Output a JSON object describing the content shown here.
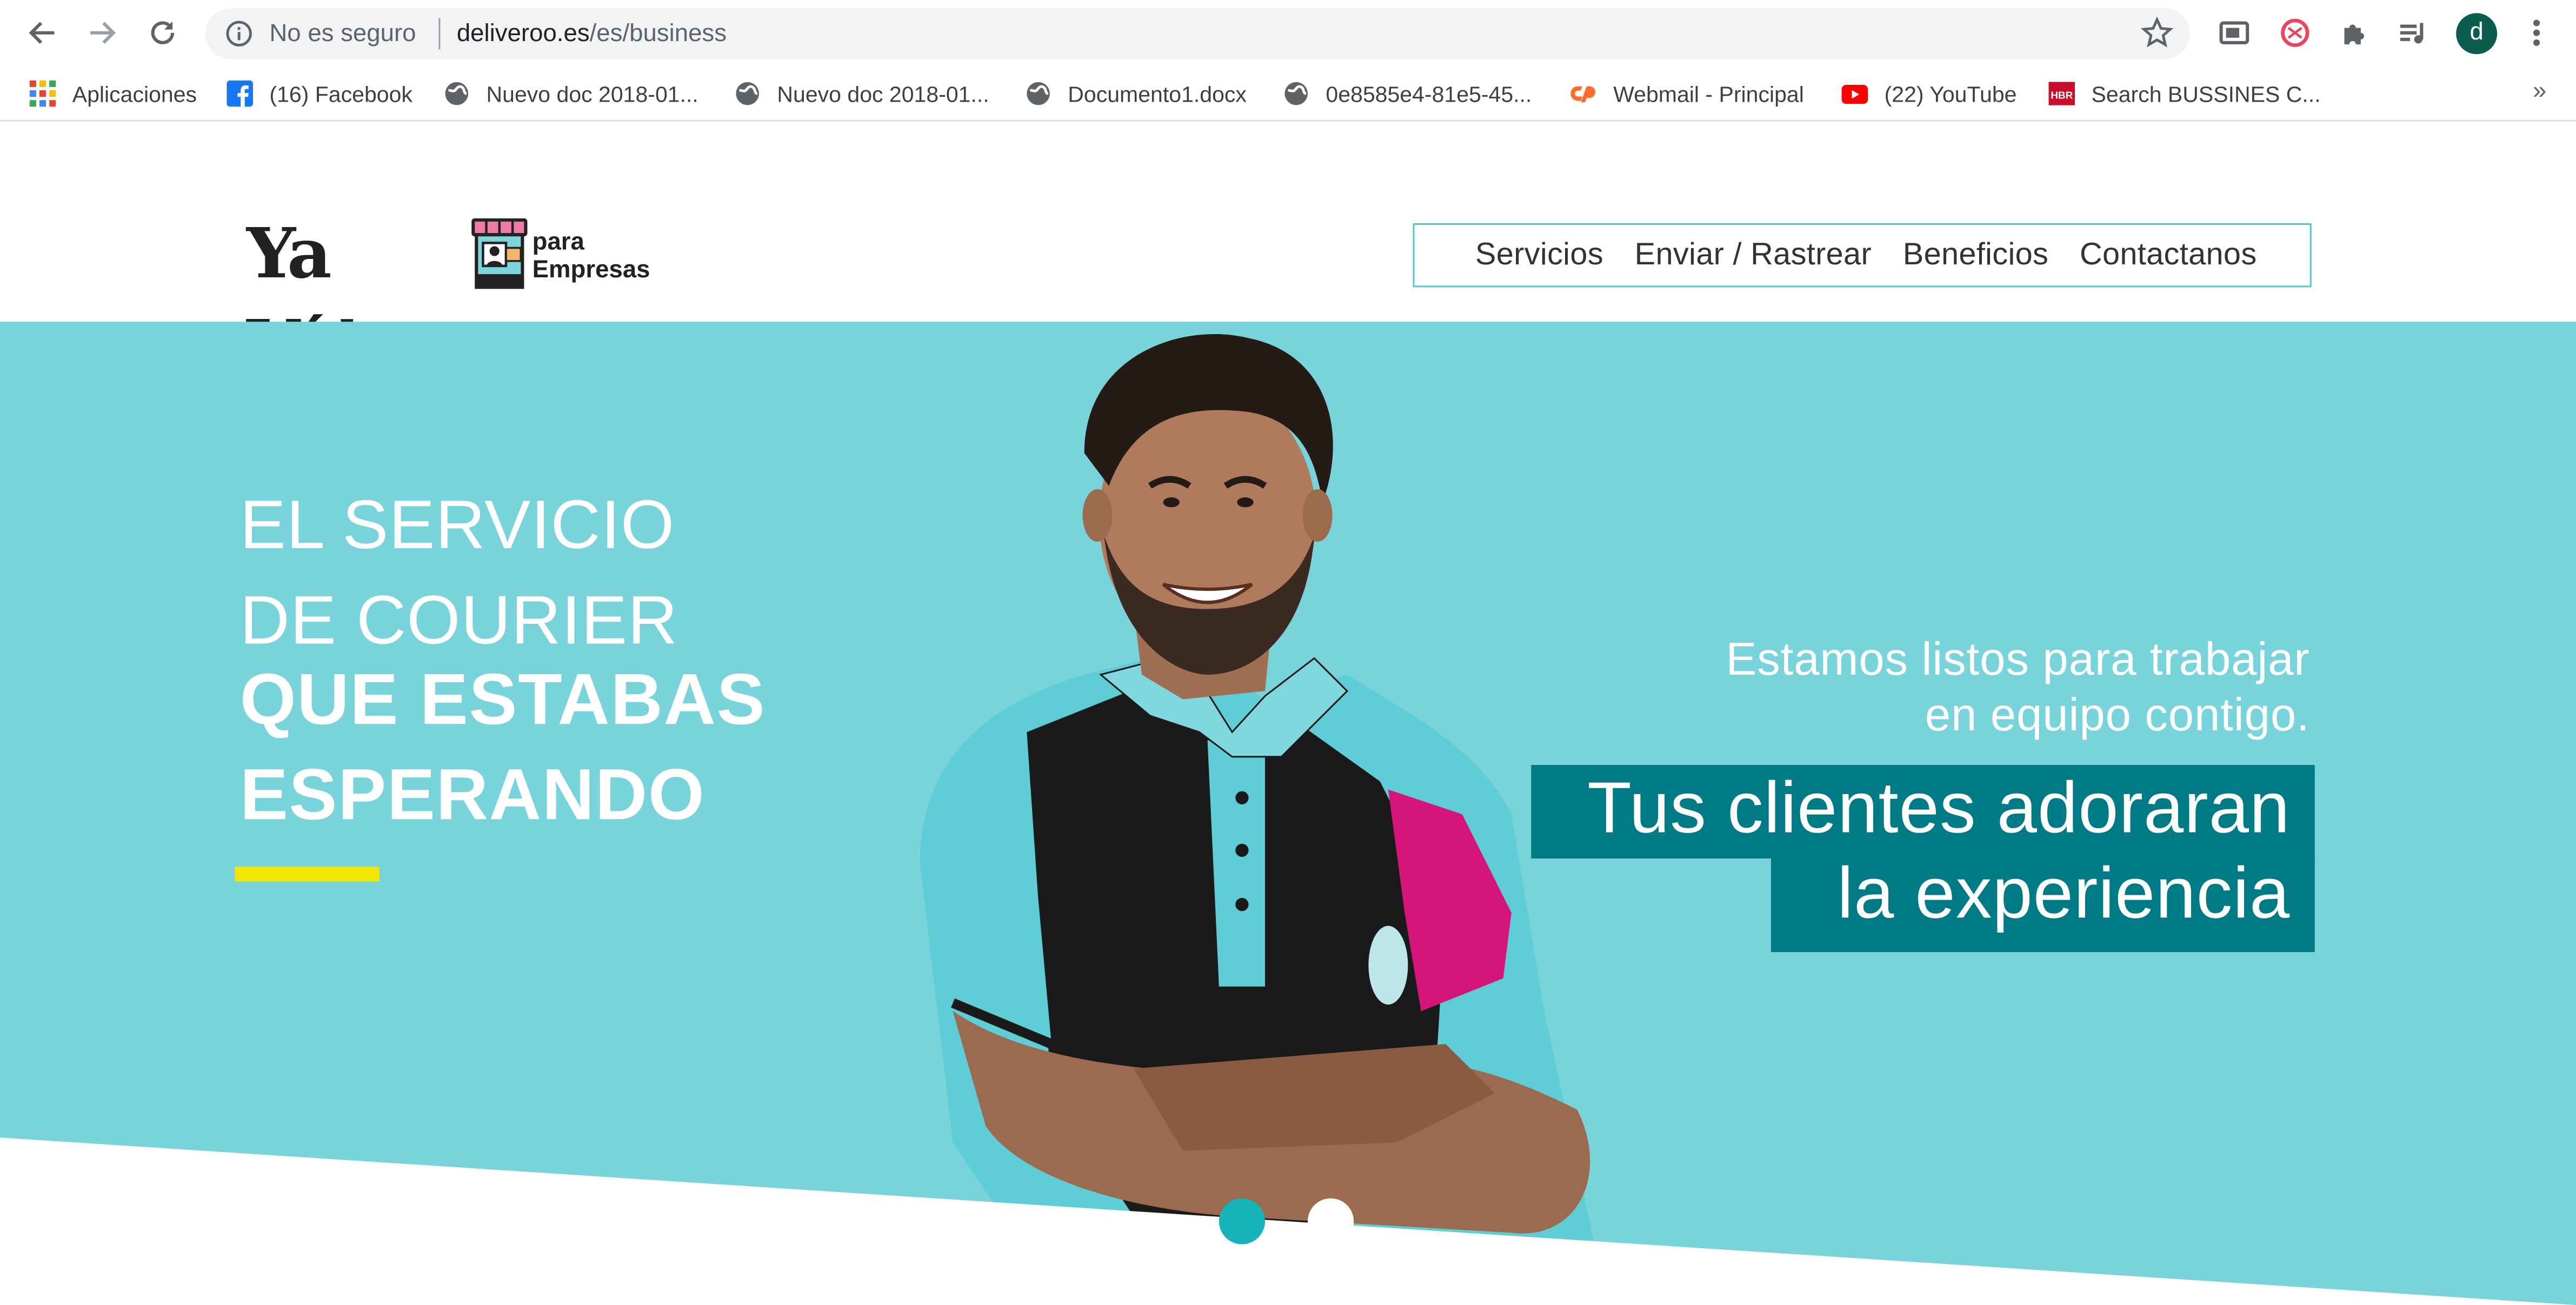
{
  "browser": {
    "insecure_label": "No es seguro",
    "url_host": "deliveroo.es",
    "url_path": "/es/business",
    "profile_initial": "d"
  },
  "bookmarks": [
    {
      "label": "Aplicaciones",
      "icon": "apps-grid-icon"
    },
    {
      "label": "(16) Facebook",
      "icon": "facebook-icon"
    },
    {
      "label": "Nuevo doc 2018-01...",
      "icon": "globe-icon"
    },
    {
      "label": "Nuevo doc 2018-01...",
      "icon": "globe-icon"
    },
    {
      "label": "Documento1.docx",
      "icon": "globe-icon"
    },
    {
      "label": "0e8585e4-81e5-45...",
      "icon": "globe-icon"
    },
    {
      "label": "Webmail - Principal",
      "icon": "cpanel-icon"
    },
    {
      "label": "(22) YouTube",
      "icon": "youtube-icon"
    },
    {
      "label": "Search BUSSINES C...",
      "icon": "hbr-icon"
    }
  ],
  "bookmarks_more": "»",
  "logo": {
    "brand": "Ya Vá",
    "exclaim": "!",
    "para": "para",
    "empresas": "Empresas"
  },
  "nav": [
    "Servicios",
    "Enviar / Rastrear",
    "Beneficios",
    "Contactanos"
  ],
  "hero": {
    "line1": "EL SERVICIO",
    "line2": "DE COURIER",
    "line3": "QUE ESTABAS",
    "line4": "ESPERANDO",
    "right_line1": "Estamos listos para trabajar",
    "right_line2": "en equipo contigo.",
    "big_line1": "Tus clientes adoraran",
    "big_line2": "la experiencia"
  },
  "colors": {
    "hero_bg": "#78d3da",
    "teal_box": "#007a84",
    "yellow_accent": "#f3e600",
    "active_dot": "#15b3ba"
  },
  "carousel": {
    "active_slide": 1,
    "slides": 2
  }
}
